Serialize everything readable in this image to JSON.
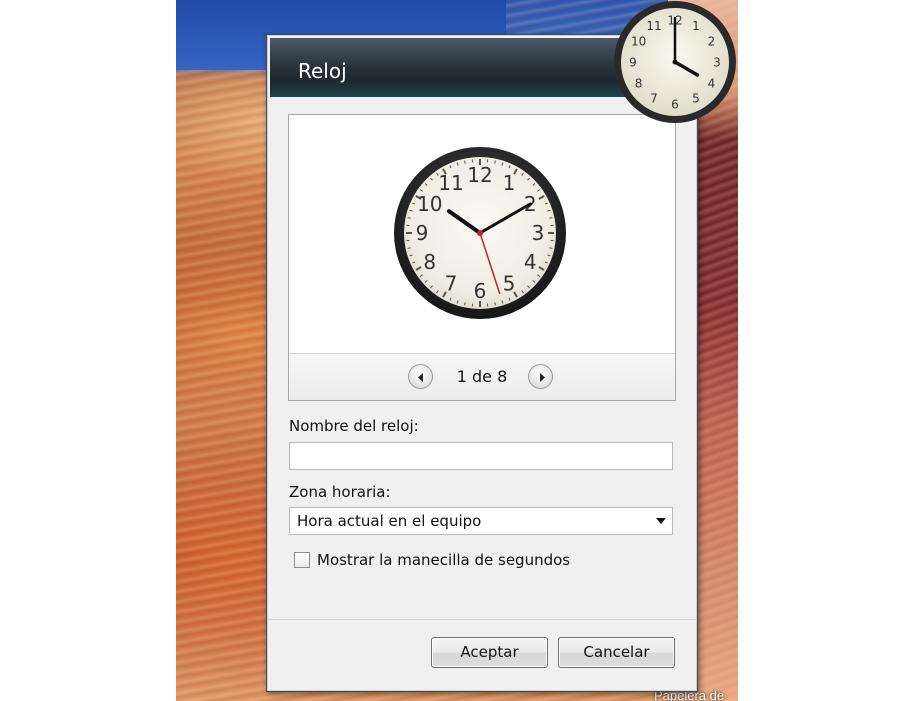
{
  "dialog": {
    "title": "Reloj",
    "preview": {
      "counter": "1 de 8",
      "clock_numbers": [
        "12",
        "1",
        "2",
        "3",
        "4",
        "5",
        "6",
        "7",
        "8",
        "9",
        "10",
        "11"
      ],
      "time_shown": "10:10:27"
    },
    "name_label": "Nombre del reloj:",
    "name_value": "",
    "zone_label": "Zona horaria:",
    "zone_value": "Hora actual en el equipo",
    "seconds_checkbox_label": "Mostrar la manecilla de segundos",
    "seconds_checked": false,
    "ok_label": "Aceptar",
    "cancel_label": "Cancelar"
  },
  "desktop": {
    "recycle_bin_label": "Papelera de",
    "gadget_clock_numbers": [
      "12",
      "1",
      "2",
      "3",
      "4",
      "5",
      "6",
      "7",
      "8",
      "9",
      "10",
      "11"
    ],
    "gadget_time": "4:00"
  },
  "colors": {
    "titlebar": "#1a242c",
    "dialog_bg": "#f0f0f0",
    "second_hand": "#c8202a"
  },
  "icons": {
    "prev": "circle-left-arrow-icon",
    "next": "circle-right-arrow-icon",
    "dropdown": "triangle-down-icon"
  }
}
